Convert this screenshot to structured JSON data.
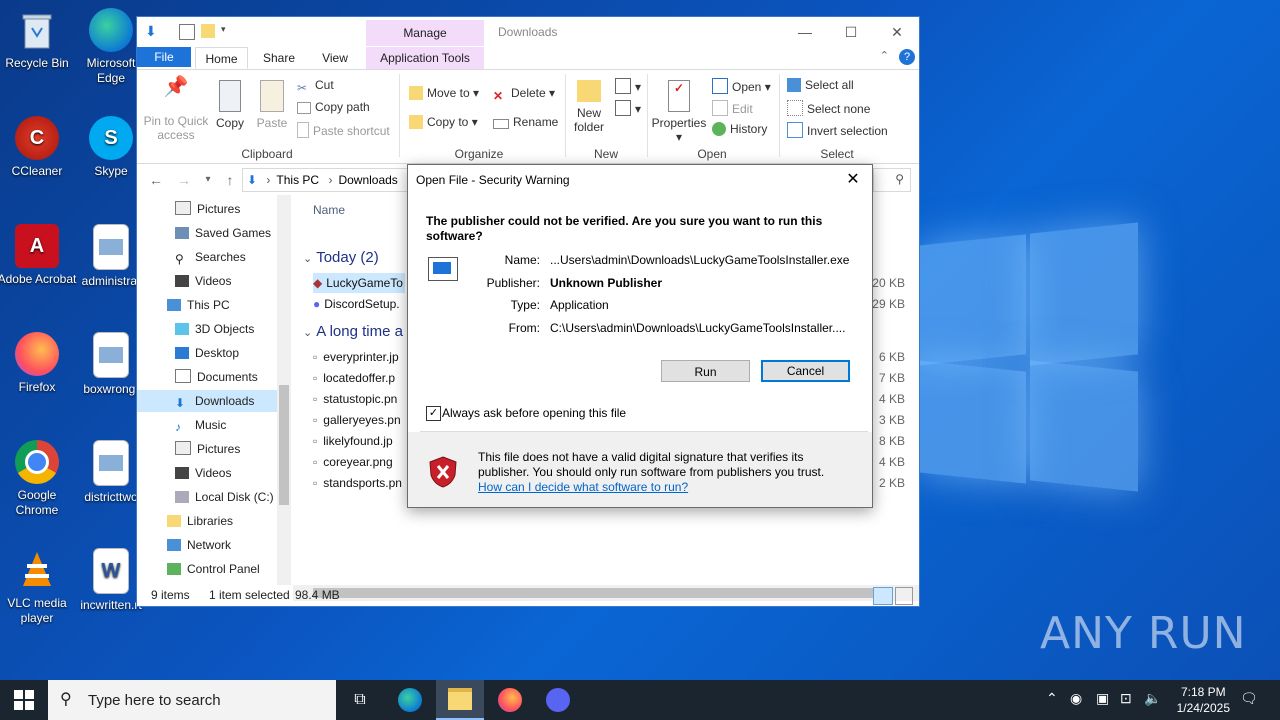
{
  "desktop": {
    "icons": [
      {
        "label": "Recycle Bin"
      },
      {
        "label": "Microsoft Edge"
      },
      {
        "label": "CCleaner"
      },
      {
        "label": "Skype"
      },
      {
        "label": "Adobe Acrobat"
      },
      {
        "label": "administrat"
      },
      {
        "label": "Firefox"
      },
      {
        "label": "boxwrong."
      },
      {
        "label": "Google Chrome"
      },
      {
        "label": "districttwo"
      },
      {
        "label": "VLC media player"
      },
      {
        "label": "incwritten.rt"
      }
    ],
    "watermark": "ANY RUN"
  },
  "explorer": {
    "title": "Downloads",
    "manage_tab": "Manage",
    "tabs": {
      "file": "File",
      "home": "Home",
      "share": "Share",
      "view": "View",
      "app_tools": "Application Tools"
    },
    "clipboard": {
      "pin": "Pin to Quick access",
      "copy": "Copy",
      "paste": "Paste",
      "cut": "Cut",
      "copy_path": "Copy path",
      "paste_shortcut": "Paste shortcut",
      "label": "Clipboard"
    },
    "organize": {
      "move_to": "Move to",
      "copy_to": "Copy to",
      "delete": "Delete",
      "rename": "Rename",
      "label": "Organize"
    },
    "new": {
      "new_folder": "New folder",
      "label": "New"
    },
    "open": {
      "properties": "Properties",
      "open": "Open",
      "edit": "Edit",
      "history": "History",
      "label": "Open"
    },
    "select": {
      "select_all": "Select all",
      "select_none": "Select none",
      "invert": "Invert selection",
      "label": "Select"
    },
    "address": {
      "this_pc": "This PC",
      "downloads": "Downloads"
    },
    "nav": [
      {
        "label": "Pictures"
      },
      {
        "label": "Saved Games"
      },
      {
        "label": "Searches"
      },
      {
        "label": "Videos"
      },
      {
        "label": "This PC"
      },
      {
        "label": "3D Objects"
      },
      {
        "label": "Desktop"
      },
      {
        "label": "Documents"
      },
      {
        "label": "Downloads"
      },
      {
        "label": "Music"
      },
      {
        "label": "Pictures"
      },
      {
        "label": "Videos"
      },
      {
        "label": "Local Disk (C:)"
      },
      {
        "label": "Libraries"
      },
      {
        "label": "Network"
      },
      {
        "label": "Control Panel"
      }
    ],
    "column_name": "Name",
    "group_today": "Today (2)",
    "group_longtime": "A long time a",
    "today_files": [
      {
        "name": "LuckyGameTo",
        "size": "320 KB"
      },
      {
        "name": "DiscordSetup.",
        "size": "329 KB"
      }
    ],
    "old_files": [
      {
        "name": "everyprinter.jp",
        "size": "6 KB"
      },
      {
        "name": "locatedoffer.p",
        "size": "7 KB"
      },
      {
        "name": "statustopic.pn",
        "size": "4 KB"
      },
      {
        "name": "galleryeyes.pn",
        "size": "3 KB"
      },
      {
        "name": "likelyfound.jp",
        "size": "8 KB"
      },
      {
        "name": "coreyear.png",
        "size": "4 KB"
      },
      {
        "name": "standsports.pn",
        "size": "2 KB"
      }
    ],
    "status": {
      "count": "9 items",
      "selected": "1 item selected",
      "size": "98.4 MB"
    }
  },
  "dialog": {
    "title": "Open File - Security Warning",
    "question": "The publisher could not be verified.  Are you sure you want to run this software?",
    "name_label": "Name:",
    "name_value": "...Users\\admin\\Downloads\\LuckyGameToolsInstaller.exe",
    "publisher_label": "Publisher:",
    "publisher_value": "Unknown Publisher",
    "type_label": "Type:",
    "type_value": "Application",
    "from_label": "From:",
    "from_value": "C:\\Users\\admin\\Downloads\\LuckyGameToolsInstaller....",
    "run": "Run",
    "cancel": "Cancel",
    "always_ask": "Always ask before opening this file",
    "always_ask_checked": true,
    "warning": "This file does not have a valid digital signature that verifies its publisher.  You should only run software from publishers you trust.",
    "help_link": "How can I decide what software to run?"
  },
  "taskbar": {
    "search_placeholder": "Type here to search",
    "time": "7:18 PM",
    "date": "1/24/2025"
  }
}
